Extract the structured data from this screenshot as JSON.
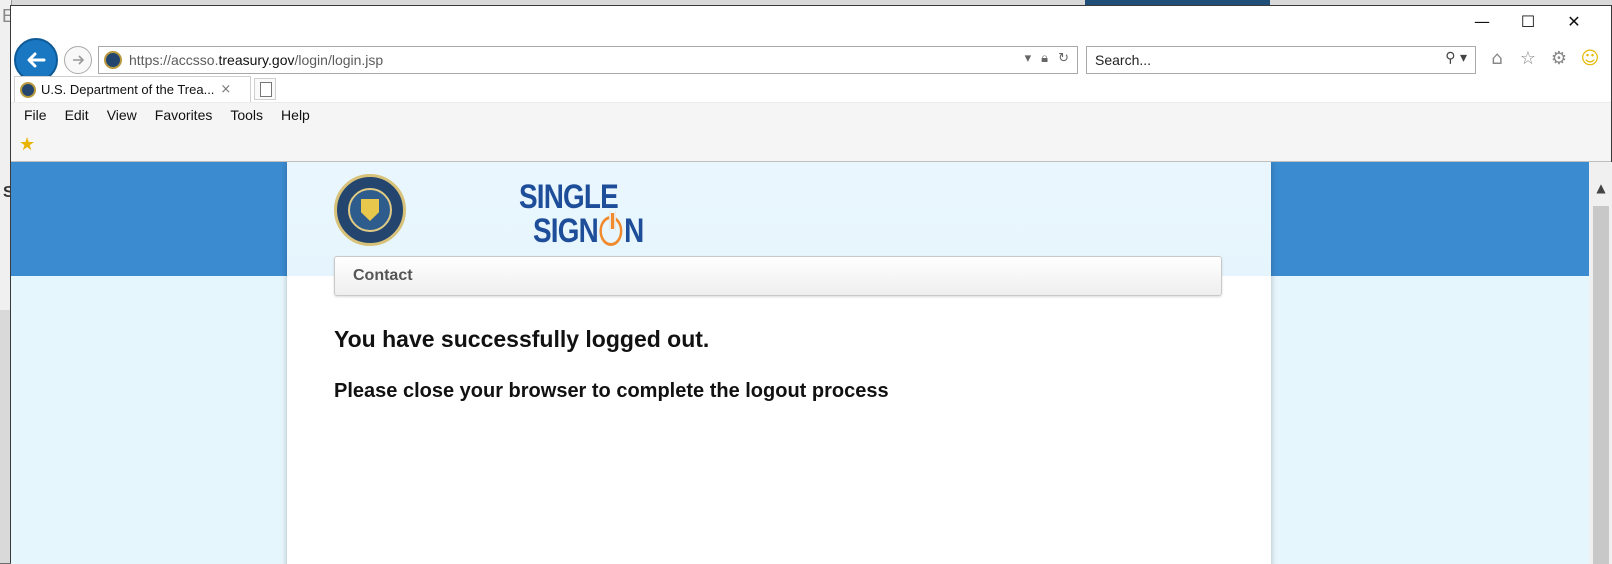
{
  "browser": {
    "window_controls": {
      "minimize": "—",
      "maximize": "☐",
      "close": "✕"
    },
    "address": {
      "url_prefix": "https://accsso.",
      "url_domain": "treasury.gov",
      "url_path": "/login/login.jsp"
    },
    "search": {
      "placeholder": "Search..."
    },
    "tab": {
      "title": "U.S. Department of the Trea...",
      "close": "×"
    },
    "menu": [
      "File",
      "Edit",
      "View",
      "Favorites",
      "Tools",
      "Help"
    ],
    "colors": {
      "back_button": "#1a78c2",
      "page_band": "#3b8bd0",
      "page_bg": "#e6f6fd",
      "logo_blue": "#1e4e9a",
      "logo_orange": "#f08a2c"
    }
  },
  "page": {
    "logo": {
      "line1": "SINGLE",
      "line2_prefix": "SIGN",
      "line2_suffix": "N"
    },
    "nav": {
      "contact": "Contact"
    },
    "message_title": "You have successfully logged out.",
    "message_body": "Please close your browser to complete the logout process"
  },
  "background": {
    "edge_letter_top": "E",
    "edge_letter_mid": "S"
  }
}
